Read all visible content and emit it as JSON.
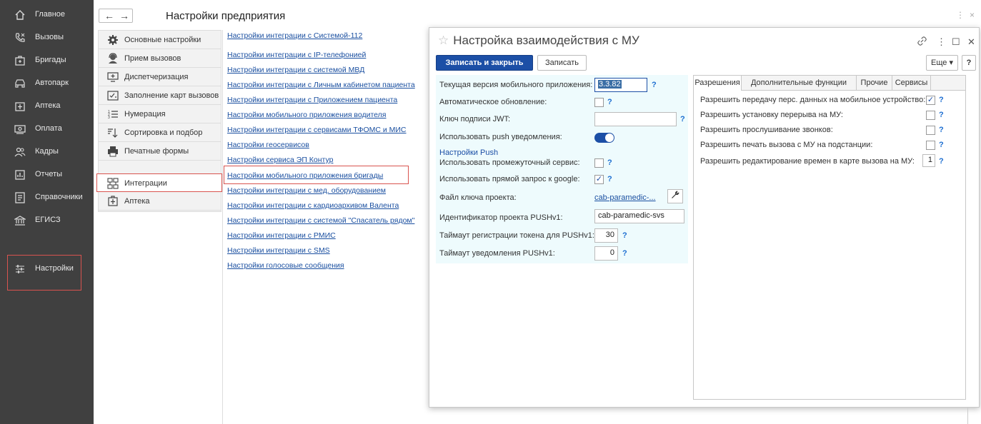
{
  "sidebar": {
    "items": [
      {
        "label": "Главное",
        "icon": "home-icon"
      },
      {
        "label": "Вызовы",
        "icon": "phone-icon"
      },
      {
        "label": "Бригады",
        "icon": "brigade-icon"
      },
      {
        "label": "Автопарк",
        "icon": "car-icon"
      },
      {
        "label": "Аптека",
        "icon": "pharmacy-icon"
      },
      {
        "label": "Оплата",
        "icon": "payment-icon"
      },
      {
        "label": "Кадры",
        "icon": "staff-icon"
      },
      {
        "label": "Отчеты",
        "icon": "reports-icon"
      },
      {
        "label": "Справочники",
        "icon": "directory-icon"
      },
      {
        "label": "ЕГИСЗ",
        "icon": "building-icon"
      },
      {
        "label": "Настройки",
        "icon": "settings-sliders-icon"
      }
    ]
  },
  "topbar": {
    "title": "Настройки предприятия",
    "back": "←",
    "forward": "→",
    "more": "⋮",
    "close": "×"
  },
  "leftnav": {
    "items": [
      {
        "label": "Основные настройки",
        "icon": "gear-icon"
      },
      {
        "label": "Прием вызовов",
        "icon": "operator-icon"
      },
      {
        "label": "Диспетчеризация",
        "icon": "dispatch-icon"
      },
      {
        "label": "Заполнение карт вызовов",
        "icon": "card-check-icon"
      },
      {
        "label": "Нумерация",
        "icon": "numbering-icon"
      },
      {
        "label": "Сортировка и подбор",
        "icon": "sort-icon"
      },
      {
        "label": "Печатные формы",
        "icon": "printer-icon"
      },
      {
        "label": "Интеграции",
        "icon": "integration-icon"
      },
      {
        "label": "Аптека",
        "icon": "pharmacy-icon"
      }
    ]
  },
  "links": [
    "Настройки интеграции с Системой-112",
    "Настройки интеграции с IP-телефонией",
    "Настройки интеграции с системой МВД",
    "Настройки интеграции с Личным кабинетом пациента",
    "Настройки интеграции с Приложением пациента",
    "Настройки мобильного приложения водителя",
    "Настройки интеграции с сервисами ТФОМС и МИС",
    "Настройки геосервисов",
    "Настройки сервиса ЭП Контур",
    "Настройки мобильного приложения бригады",
    "Настройки интеграции с мед. оборудованием",
    "Настройки интеграции с кардиоархивом Валента",
    "Настройки интеграции с системой \"Спасатель рядом\"",
    "Настройки интеграции с РМИС",
    "Настройки интеграции с SMS",
    "Настройки голосовые сообщения"
  ],
  "dialog": {
    "star": "☆",
    "title": "Настройка взаимодействия с МУ",
    "icons": {
      "link": "🔗",
      "more": "⋮",
      "maximize": "☐",
      "close": "✕"
    },
    "buttons": {
      "save_close": "Записать и закрыть",
      "save": "Записать",
      "more": "Еще ▾",
      "help": "?"
    },
    "form": {
      "version_label": "Текущая версия мобильного приложения:",
      "version_value": "3.3.82",
      "auto_update_label": "Автоматическое обновление:",
      "jwt_label": "Ключ подписи JWT:",
      "jwt_value": "",
      "push_label": "Использовать push уведомления:",
      "push_section": "Настройки Push",
      "intermediate_label": "Использовать промежуточный сервис:",
      "google_label": "Использовать прямой запрос к google:",
      "keyfile_label": "Файл ключа проекта:",
      "keyfile_value": "cab-paramedic-...",
      "project_id_label": "Идентификатор проекта PUSHv1:",
      "project_id_value": "cab-paramedic-svs",
      "token_timeout_label": "Таймаут регистрации токена для PUSHv1:",
      "token_timeout_value": "30",
      "notify_timeout_label": "Таймаут уведомления PUSHv1:",
      "notify_timeout_value": "0",
      "help": "?",
      "check": "✓",
      "wrench": "🔧"
    },
    "tabs": [
      "Разрешения",
      "Дополнительные функции",
      "Прочие",
      "Сервисы"
    ],
    "permissions": [
      {
        "label": "Разрешить передачу перс. данных на мобильное устройство:",
        "checked": true
      },
      {
        "label": "Разрешить установку перерыва на МУ:",
        "checked": false
      },
      {
        "label": "Разрешить прослушивание звонков:",
        "checked": false
      },
      {
        "label": "Разрешить печать вызова с МУ на подстанции:",
        "checked": false
      },
      {
        "label": "Разрешить редактирование времен в карте вызова на МУ:",
        "value": "1"
      }
    ]
  }
}
